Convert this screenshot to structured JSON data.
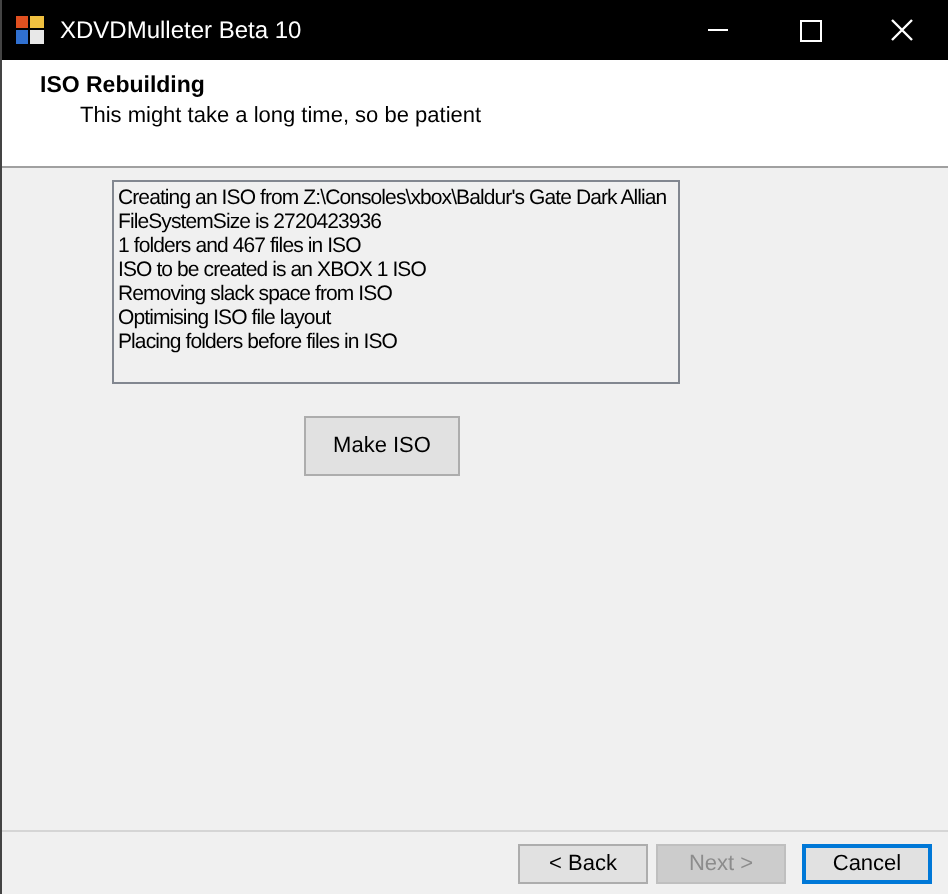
{
  "window": {
    "title": "XDVDMulleter Beta 10"
  },
  "header": {
    "title": "ISO Rebuilding",
    "subtitle": "This might take a long time, so be patient"
  },
  "log": [
    "Creating an ISO from Z:\\Consoles\\xbox\\Baldur's Gate Dark Allian",
    "FileSystemSize is 2720423936",
    "1 folders and 467 files in ISO",
    "ISO to be created is an XBOX 1 ISO",
    "Removing slack space from ISO",
    "Optimising ISO file layout",
    "Placing folders before files in ISO"
  ],
  "action_button": {
    "label": "Make ISO"
  },
  "buttons": [
    {
      "label": "< Back",
      "disabled": false,
      "focused": false
    },
    {
      "label": "Next >",
      "disabled": true,
      "focused": false
    },
    {
      "label": "Cancel",
      "disabled": false,
      "focused": true
    }
  ]
}
